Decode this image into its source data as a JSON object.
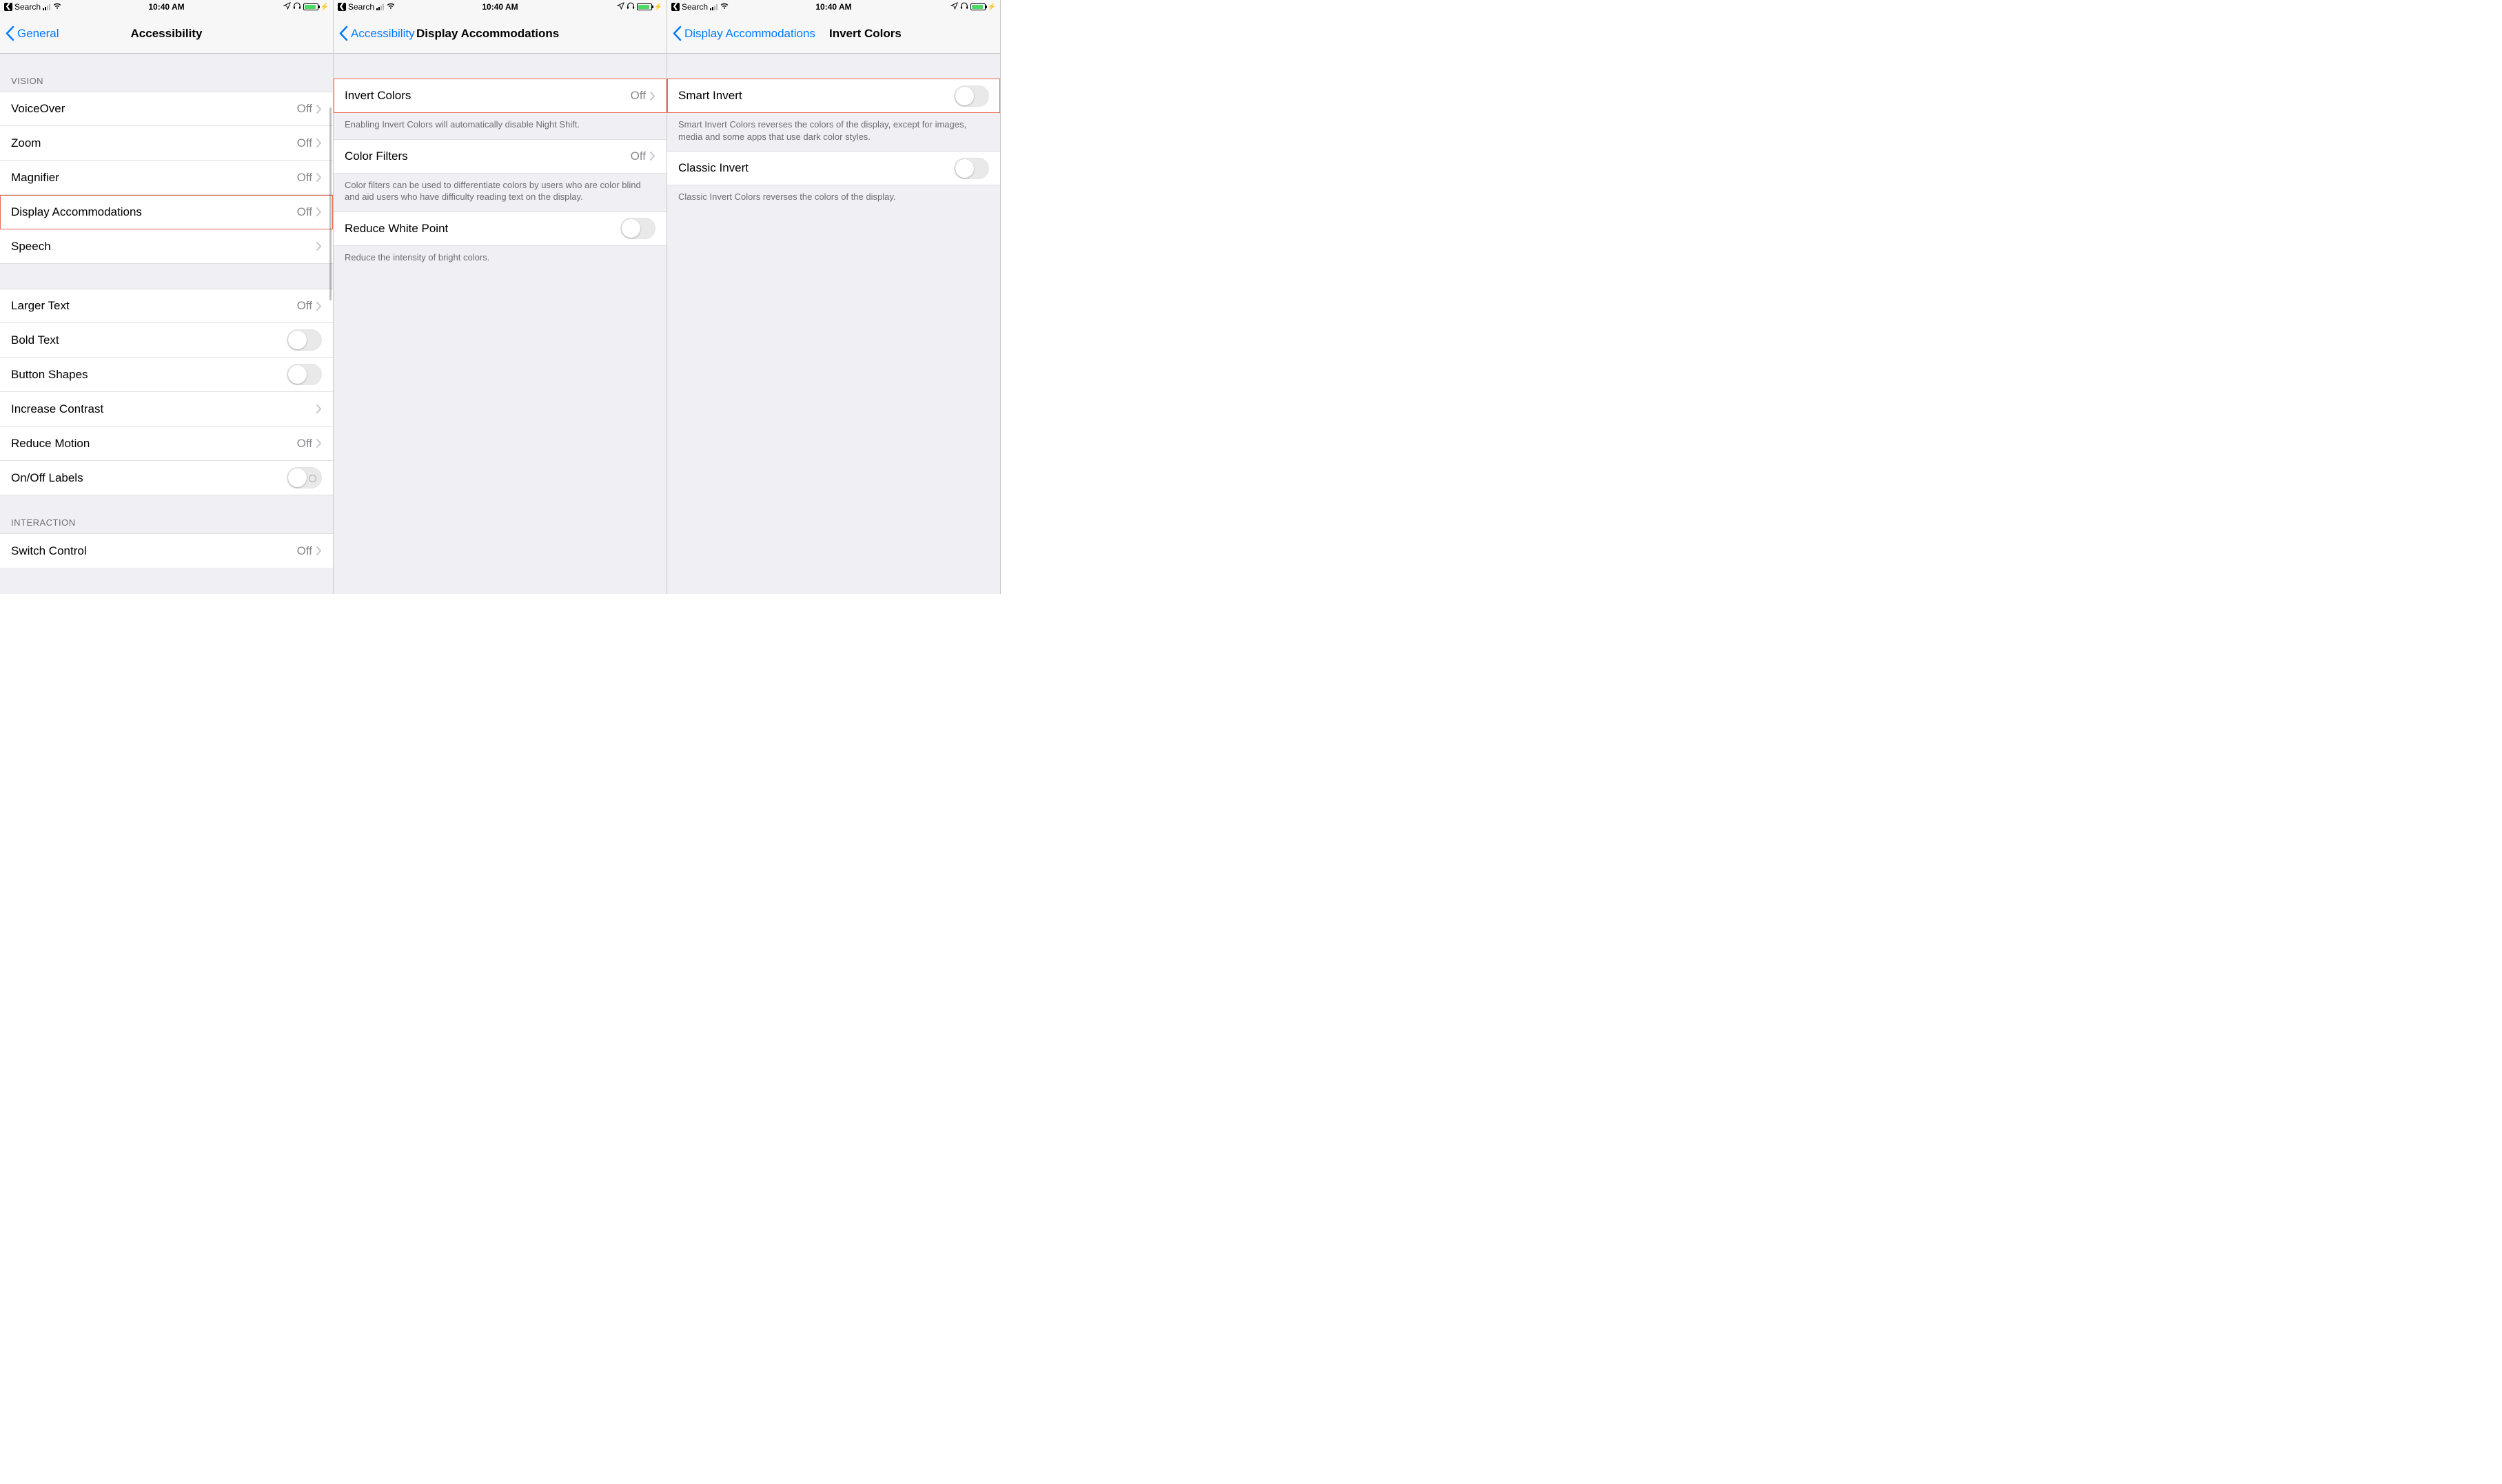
{
  "statusBar": {
    "searchLabel": "Search",
    "time": "10:40 AM"
  },
  "screen1": {
    "backLabel": "General",
    "title": "Accessibility",
    "headerVision": "VISION",
    "headerInteraction": "INTERACTION",
    "items": {
      "voiceover": {
        "label": "VoiceOver",
        "value": "Off"
      },
      "zoom": {
        "label": "Zoom",
        "value": "Off"
      },
      "magnifier": {
        "label": "Magnifier",
        "value": "Off"
      },
      "displayAccommodations": {
        "label": "Display Accommodations",
        "value": "Off"
      },
      "speech": {
        "label": "Speech"
      },
      "largerText": {
        "label": "Larger Text",
        "value": "Off"
      },
      "boldText": {
        "label": "Bold Text"
      },
      "buttonShapes": {
        "label": "Button Shapes"
      },
      "increaseContrast": {
        "label": "Increase Contrast"
      },
      "reduceMotion": {
        "label": "Reduce Motion",
        "value": "Off"
      },
      "onOffLabels": {
        "label": "On/Off Labels"
      },
      "switchControl": {
        "label": "Switch Control",
        "value": "Off"
      }
    }
  },
  "screen2": {
    "backLabel": "Accessibility",
    "title": "Display Accommodations",
    "items": {
      "invertColors": {
        "label": "Invert Colors",
        "value": "Off"
      },
      "colorFilters": {
        "label": "Color Filters",
        "value": "Off"
      },
      "reduceWhitePoint": {
        "label": "Reduce White Point"
      }
    },
    "footers": {
      "invert": "Enabling Invert Colors will automatically disable Night Shift.",
      "filters": "Color filters can be used to differentiate colors by users who are color blind and aid users who have difficulty reading text on the display.",
      "whitepoint": "Reduce the intensity of bright colors."
    }
  },
  "screen3": {
    "backLabel": "Display Accommodations",
    "title": "Invert Colors",
    "items": {
      "smartInvert": {
        "label": "Smart Invert"
      },
      "classicInvert": {
        "label": "Classic Invert"
      }
    },
    "footers": {
      "smart": "Smart Invert Colors reverses the colors of the display, except for images, media and some apps that use dark color styles.",
      "classic": "Classic Invert Colors reverses the colors of the display."
    }
  }
}
